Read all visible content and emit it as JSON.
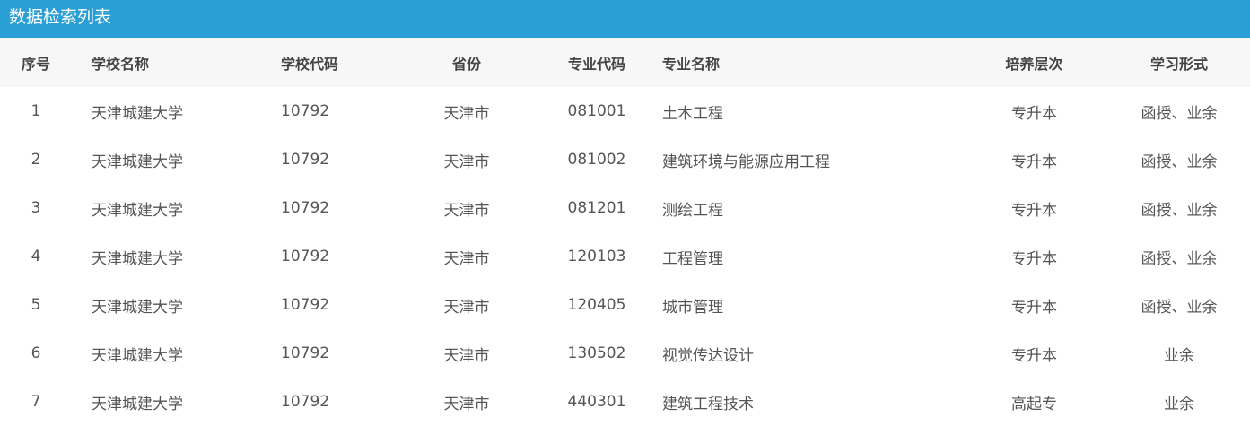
{
  "title": "数据检索列表",
  "columns": [
    "序号",
    "学校名称",
    "学校代码",
    "省份",
    "专业代码",
    "专业名称",
    "培养层次",
    "学习形式"
  ],
  "rows": [
    [
      "1",
      "天津城建大学",
      "10792",
      "天津市",
      "081001",
      "土木工程",
      "专升本",
      "函授、业余"
    ],
    [
      "2",
      "天津城建大学",
      "10792",
      "天津市",
      "081002",
      "建筑环境与能源应用工程",
      "专升本",
      "函授、业余"
    ],
    [
      "3",
      "天津城建大学",
      "10792",
      "天津市",
      "081201",
      "测绘工程",
      "专升本",
      "函授、业余"
    ],
    [
      "4",
      "天津城建大学",
      "10792",
      "天津市",
      "120103",
      "工程管理",
      "专升本",
      "函授、业余"
    ],
    [
      "5",
      "天津城建大学",
      "10792",
      "天津市",
      "120405",
      "城市管理",
      "专升本",
      "函授、业余"
    ],
    [
      "6",
      "天津城建大学",
      "10792",
      "天津市",
      "130502",
      "视觉传达设计",
      "专升本",
      "业余"
    ],
    [
      "7",
      "天津城建大学",
      "10792",
      "天津市",
      "440301",
      "建筑工程技术",
      "高起专",
      "业余"
    ]
  ],
  "colors": {
    "accent": "#2a9fd6",
    "header_bg": "#f7f7f7"
  }
}
